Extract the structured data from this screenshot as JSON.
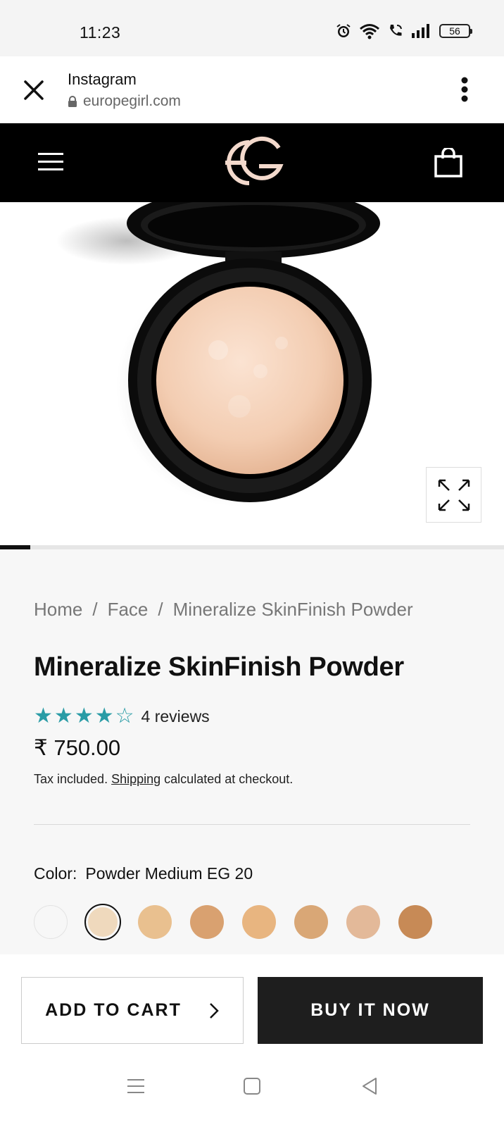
{
  "status_bar": {
    "time": "11:23",
    "battery": "56",
    "icons": [
      "alarm-icon",
      "wifi-icon",
      "wifi-call-icon",
      "signal-icon",
      "battery-icon"
    ]
  },
  "browser": {
    "title": "Instagram",
    "url": "europegirl.com"
  },
  "header": {
    "brand_color": "#000000",
    "logo_color": "#f3d9cc"
  },
  "product": {
    "breadcrumb": [
      "Home",
      "Face",
      "Mineralize SkinFinish Powder"
    ],
    "title": "Mineralize SkinFinish Powder",
    "rating": 4,
    "rating_max": 5,
    "reviews": "4 reviews",
    "price": "₹ 750.00",
    "tax_prefix": "Tax included.",
    "tax_link": "Shipping",
    "tax_suffix": "calculated at checkout.",
    "color_label": "Color:",
    "color_value": "Powder Medium EG 20",
    "swatches": [
      "#f7f7f7",
      "#efd9bd",
      "#e9c08f",
      "#d9a170",
      "#e8b580",
      "#d9a776",
      "#e3b999",
      "#c78a56"
    ],
    "selected_swatch": 1,
    "star_color": "#2a9ca6",
    "image_progress": 0.06
  },
  "actions": {
    "add_to_cart": "ADD TO CART",
    "buy_now": "BUY IT NOW"
  },
  "system_nav": {
    "icons": [
      "menu-icon",
      "home-icon",
      "back-icon"
    ]
  }
}
